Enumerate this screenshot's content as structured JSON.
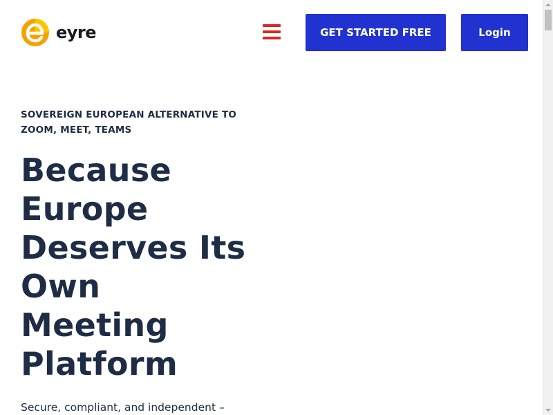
{
  "header": {
    "logo_text": "eyre",
    "logo_icon": "eyre-e-logo-icon",
    "menu_icon": "hamburger-menu-icon",
    "cta_label": "GET STARTED FREE",
    "login_label": "Login"
  },
  "hero": {
    "eyebrow": "SOVEREIGN EUROPEAN ALTERNATIVE TO ZOOM, MEET, TEAMS",
    "headline_lines": [
      "Because",
      "Europe",
      "Deserves Its",
      "Own",
      "Meeting",
      "Platform"
    ],
    "subtext": "Secure, compliant, and independent –"
  },
  "colors": {
    "brand_blue": "#2232d0",
    "menu_red": "#d8281f",
    "text_navy": "#1e2d45",
    "logo_orange": "#f5a200",
    "logo_yellow": "#ffc400"
  }
}
